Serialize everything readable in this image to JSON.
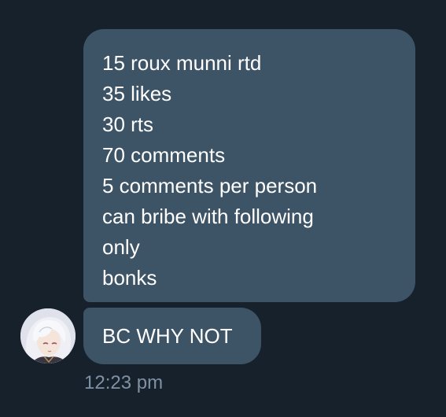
{
  "messages": [
    {
      "lines": [
        "15 roux munni rtd",
        "35 likes",
        "30 rts",
        "70 comments",
        "5 comments per person",
        "can bribe with following",
        "only",
        "bonks"
      ]
    },
    {
      "text": "BC WHY NOT"
    }
  ],
  "timestamp": "12:23 pm",
  "colors": {
    "background": "#17212b",
    "bubble": "#3d5366",
    "text": "#ffffff",
    "timestamp": "#7f91a4"
  },
  "sender": {
    "avatar_icon": "anime-character-avatar"
  }
}
